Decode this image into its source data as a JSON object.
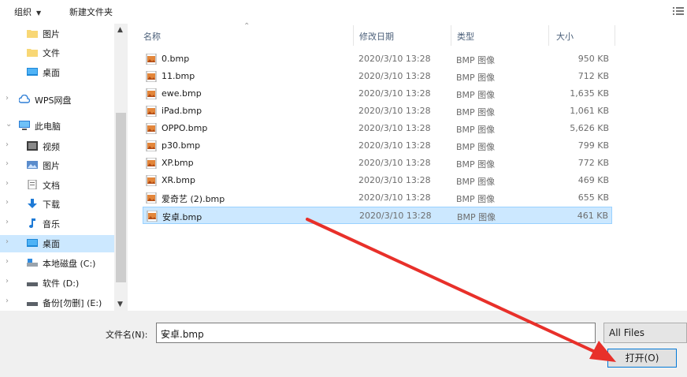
{
  "toolbar": {
    "organize": "组织",
    "new_folder": "新建文件夹"
  },
  "nav": {
    "items": [
      {
        "label": "图片",
        "icon": "folder-icon"
      },
      {
        "label": "文件",
        "icon": "folder-icon"
      },
      {
        "label": "桌面",
        "icon": "desktop-icon"
      },
      {
        "label": "WPS网盘",
        "icon": "cloud-icon"
      },
      {
        "label": "此电脑",
        "icon": "computer-icon"
      },
      {
        "label": "视频",
        "icon": "video-icon"
      },
      {
        "label": "图片",
        "icon": "pictures-icon"
      },
      {
        "label": "文档",
        "icon": "documents-icon"
      },
      {
        "label": "下载",
        "icon": "download-icon"
      },
      {
        "label": "音乐",
        "icon": "music-icon"
      },
      {
        "label": "桌面",
        "icon": "desktop-icon"
      },
      {
        "label": "本地磁盘 (C:)",
        "icon": "drive-icon"
      },
      {
        "label": "软件 (D:)",
        "icon": "drive-icon"
      },
      {
        "label": "备份[勿删] (E:)",
        "icon": "drive-icon"
      }
    ]
  },
  "columns": {
    "name": "名称",
    "date": "修改日期",
    "type": "类型",
    "size": "大小"
  },
  "files": [
    {
      "name": "0.bmp",
      "date": "2020/3/10 13:28",
      "type": "BMP 图像",
      "size": "950 KB"
    },
    {
      "name": "11.bmp",
      "date": "2020/3/10 13:28",
      "type": "BMP 图像",
      "size": "712 KB"
    },
    {
      "name": "ewe.bmp",
      "date": "2020/3/10 13:28",
      "type": "BMP 图像",
      "size": "1,635 KB"
    },
    {
      "name": "iPad.bmp",
      "date": "2020/3/10 13:28",
      "type": "BMP 图像",
      "size": "1,061 KB"
    },
    {
      "name": "OPPO.bmp",
      "date": "2020/3/10 13:28",
      "type": "BMP 图像",
      "size": "5,626 KB"
    },
    {
      "name": "p30.bmp",
      "date": "2020/3/10 13:28",
      "type": "BMP 图像",
      "size": "799 KB"
    },
    {
      "name": "XP.bmp",
      "date": "2020/3/10 13:28",
      "type": "BMP 图像",
      "size": "772 KB"
    },
    {
      "name": "XR.bmp",
      "date": "2020/3/10 13:28",
      "type": "BMP 图像",
      "size": "469 KB"
    },
    {
      "name": "爱奇艺 (2).bmp",
      "date": "2020/3/10 13:28",
      "type": "BMP 图像",
      "size": "655 KB"
    },
    {
      "name": "安卓.bmp",
      "date": "2020/3/10 13:28",
      "type": "BMP 图像",
      "size": "461 KB"
    }
  ],
  "footer": {
    "filename_label": "文件名(N):",
    "filename_value": "安卓.bmp",
    "filter": "All Files",
    "open_button": "打开(O)"
  },
  "colors": {
    "selection": "#cce8ff",
    "arrow": "#e8302a",
    "accent": "#0078d7"
  }
}
